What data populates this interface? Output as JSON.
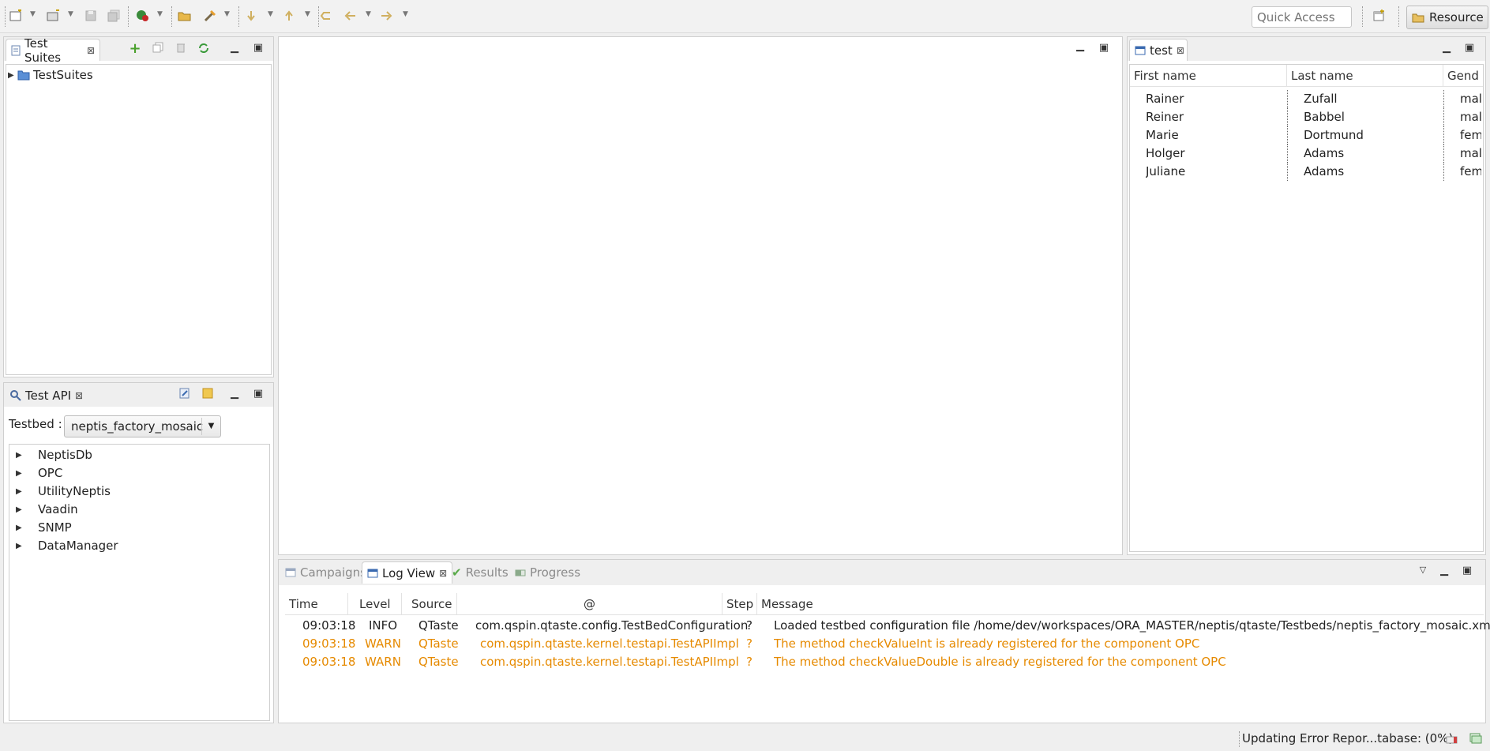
{
  "toolbar": {
    "quick_access_placeholder": "Quick Access",
    "perspective_label": "Resource",
    "icons": [
      "new-wizard-icon",
      "new-folder-icon",
      "save-icon",
      "save-all-icon",
      "run-icon",
      "open-icon",
      "build-icon",
      "next-annotation-icon",
      "previous-annotation-icon",
      "last-edit-icon",
      "back-icon",
      "forward-icon",
      "open-perspective-icon"
    ]
  },
  "test_suites": {
    "tab_label": "Test Suites",
    "tree": [
      {
        "label": "TestSuites"
      }
    ]
  },
  "test_api": {
    "tab_label": "Test API",
    "testbed_label": "Testbed :",
    "testbed_value": "neptis_factory_mosaic",
    "tree": [
      {
        "label": "NeptisDb"
      },
      {
        "label": "OPC"
      },
      {
        "label": "UtilityNeptis"
      },
      {
        "label": "Vaadin"
      },
      {
        "label": "SNMP"
      },
      {
        "label": "DataManager"
      }
    ]
  },
  "test_view": {
    "tab_label": "test",
    "columns": [
      "First name",
      "Last name",
      "Gend"
    ],
    "rows": [
      {
        "first": "Rainer",
        "last": "Zufall",
        "gender": "mal"
      },
      {
        "first": "Reiner",
        "last": "Babbel",
        "gender": "mal"
      },
      {
        "first": "Marie",
        "last": "Dortmund",
        "gender": "fem"
      },
      {
        "first": "Holger",
        "last": "Adams",
        "gender": "mal"
      },
      {
        "first": "Juliane",
        "last": "Adams",
        "gender": "fem"
      }
    ]
  },
  "bottom": {
    "tabs": [
      "Campaigns",
      "Log View",
      "Results",
      "Progress"
    ],
    "columns": [
      "Time",
      "Level",
      "Source",
      "@",
      "Step",
      "Message"
    ],
    "rows": [
      {
        "time": "09:03:18",
        "level": "INFO",
        "source": "QTaste",
        "at": "com.qspin.qtaste.config.TestBedConfiguration",
        "step": "?",
        "message": "Loaded testbed configuration file /home/dev/workspaces/ORA_MASTER/neptis/qtaste/Testbeds/neptis_factory_mosaic.xml"
      },
      {
        "time": "09:03:18",
        "level": "WARN",
        "source": "QTaste",
        "at": "com.qspin.qtaste.kernel.testapi.TestAPIImpl",
        "step": "?",
        "message": "The method checkValueInt is already registered for the component OPC"
      },
      {
        "time": "09:03:18",
        "level": "WARN",
        "source": "QTaste",
        "at": "com.qspin.qtaste.kernel.testapi.TestAPIImpl",
        "step": "?",
        "message": "The method checkValueDouble is already registered for the component OPC"
      }
    ]
  },
  "status": {
    "text": "Updating Error Repor...tabase: (0%)"
  },
  "colors": {
    "warn": "#e68a00",
    "panel_border": "#cfcfcf",
    "background": "#efefef"
  }
}
